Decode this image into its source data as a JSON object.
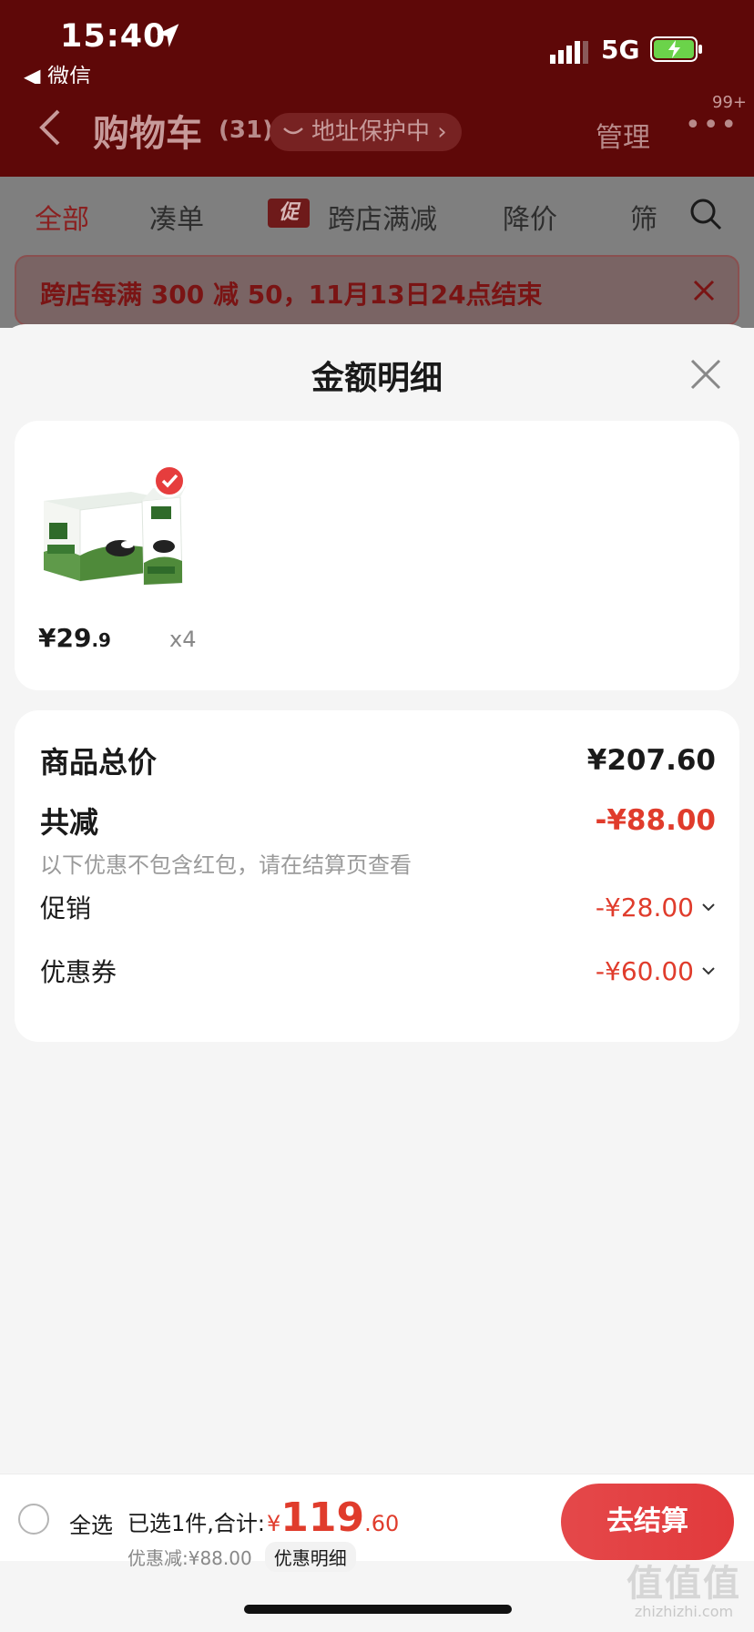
{
  "status_bar": {
    "time": "15:40",
    "back_app": "◀ 微信",
    "network": "5G"
  },
  "navbar": {
    "title": "购物车",
    "count": "(31)",
    "address_pill": "地址保护中 ›",
    "manage": "管理",
    "more": "•••",
    "badge": "99+"
  },
  "filter_tabs": {
    "all": "全部",
    "combine": "凑单",
    "cu_badge": "促",
    "cross_store": "跨店满减",
    "price_drop": "降价",
    "filter": "筛"
  },
  "promo_banner": {
    "text": "跨店每满 300 减 50，11月13日24点结束"
  },
  "sheet": {
    "title": "金额明细",
    "product": {
      "price_int": "¥29",
      "price_dec": ".9",
      "qty": "x4"
    },
    "summary": {
      "total_label": "商品总价",
      "total_value": "¥207.60",
      "reduce_label": "共减",
      "reduce_value": "-¥88.00",
      "reduce_note": "以下优惠不包含红包，请在结算页查看",
      "promo_label": "促销",
      "promo_value": "-¥28.00",
      "coupon_label": "优惠券",
      "coupon_value": "-¥60.00"
    }
  },
  "bottom_bar": {
    "select_all": "全选",
    "selected_text": "已选1件,合计:",
    "yen": "¥",
    "total_int": "119",
    "total_dec": ".60",
    "discount_text": "优惠减:¥88.00",
    "detail_link": "优惠明细",
    "checkout": "去结算"
  },
  "watermark": {
    "mark": "值值值",
    "url": "zhizhizhi.com"
  },
  "colors": {
    "accent_red": "#e03c2c",
    "nav_dark_red": "#5e0808"
  },
  "icons": [
    "location-arrow-icon",
    "signal-icon",
    "battery-charging-icon",
    "back-chevron-icon",
    "shield-icon",
    "search-icon",
    "close-icon",
    "check-icon",
    "chevron-down-icon"
  ]
}
